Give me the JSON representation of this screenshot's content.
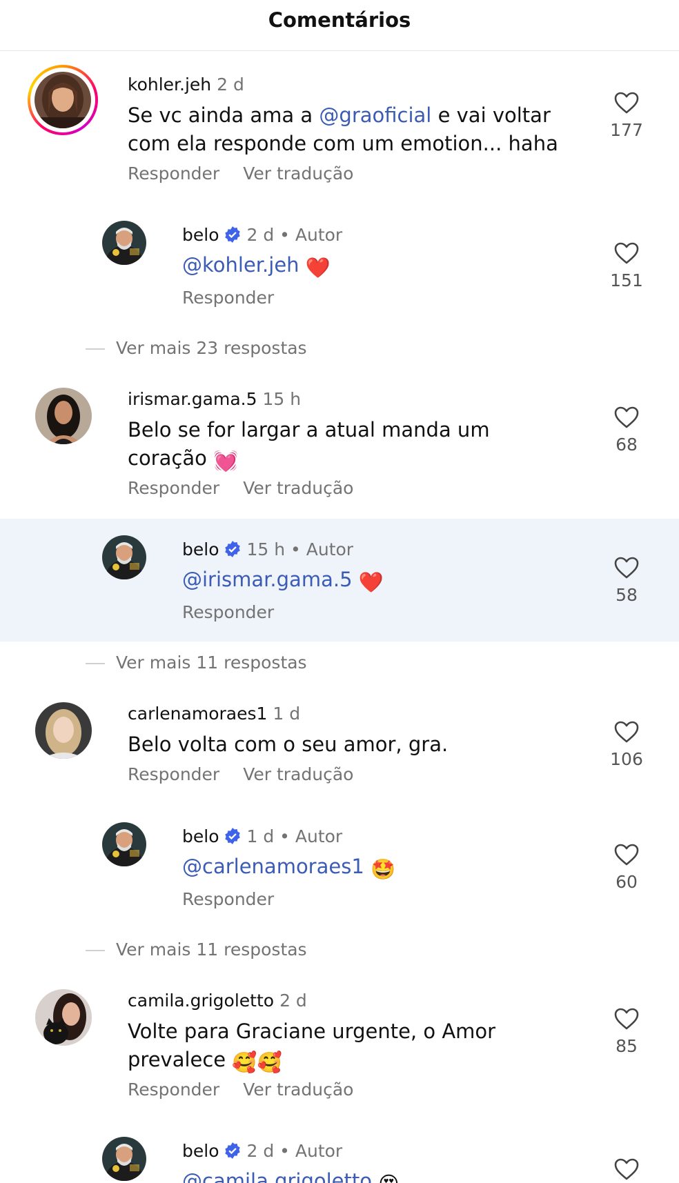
{
  "header": {
    "title": "Comentários"
  },
  "colors": {
    "mention": "#3b5bb5",
    "verified": "#3f63e8",
    "highlight": "#eff4fb",
    "muted": "#737373"
  },
  "comments": [
    {
      "username": "kohler.jeh",
      "time": "2 d",
      "text_before": "Se vc ainda ama a ",
      "mention": "@graoficial",
      "text_after": " e vai voltar com ela responde com um emotion... haha",
      "reply_label": "Responder",
      "translate_label": "Ver tradução",
      "likes": "177",
      "avatar": "woman-brown-hair-avatar"
    },
    {
      "username": "belo",
      "time": "2 d",
      "author": "Autor",
      "verified": true,
      "mention": "@kohler.jeh",
      "emoji": "❤️",
      "reply_label": "Responder",
      "likes": "151",
      "avatar": "belo-avatar"
    },
    {
      "more_replies": "Ver mais 23 respostas"
    },
    {
      "username": "irismar.gama.5",
      "time": "15 h",
      "text": "Belo se for largar a atual manda um coração",
      "emoji": "💓",
      "reply_label": "Responder",
      "translate_label": "Ver tradução",
      "likes": "68",
      "avatar": "woman-dark-hair-avatar"
    },
    {
      "username": "belo",
      "time": "15 h",
      "author": "Autor",
      "verified": true,
      "mention": "@irismar.gama.5",
      "emoji": "❤️",
      "reply_label": "Responder",
      "likes": "58",
      "avatar": "belo-avatar"
    },
    {
      "more_replies": "Ver mais 11 respostas"
    },
    {
      "username": "carlenamoraes1",
      "time": "1 d",
      "text": "Belo volta com o seu amor, gra.",
      "reply_label": "Responder",
      "translate_label": "Ver tradução",
      "likes": "106",
      "avatar": "woman-blonde-avatar"
    },
    {
      "username": "belo",
      "time": "1 d",
      "author": "Autor",
      "verified": true,
      "mention": "@carlenamoraes1",
      "emoji": "🤩",
      "reply_label": "Responder",
      "likes": "60",
      "avatar": "belo-avatar"
    },
    {
      "more_replies": "Ver mais 11 respostas"
    },
    {
      "username": "camila.grigoletto",
      "time": "2 d",
      "text": "Volte para Graciane urgente, o Amor prevalece",
      "emoji": "🥰🥰",
      "reply_label": "Responder",
      "translate_label": "Ver tradução",
      "likes": "85",
      "avatar": "woman-with-cat-avatar"
    },
    {
      "username": "belo",
      "time": "2 d",
      "author": "Autor",
      "verified": true,
      "mention": "@camila.grigoletto",
      "emoji": "😍",
      "avatar": "belo-avatar"
    }
  ]
}
